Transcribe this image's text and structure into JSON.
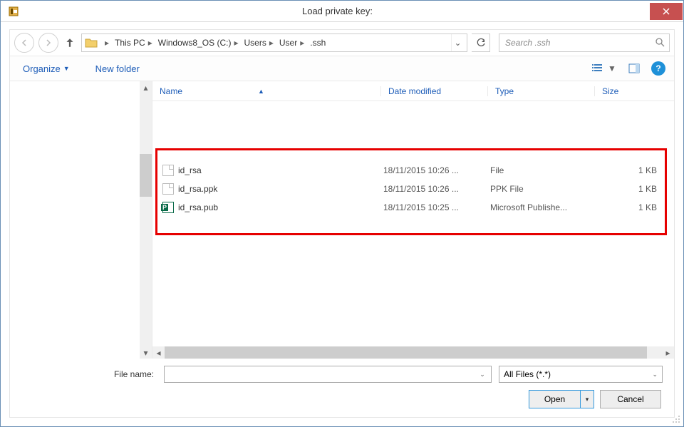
{
  "titlebar": {
    "title": "Load private key:"
  },
  "address": {
    "crumbs": [
      "This PC",
      "Windows8_OS (C:)",
      "Users",
      "User",
      ".ssh"
    ]
  },
  "search": {
    "placeholder": "Search .ssh"
  },
  "toolbar": {
    "organize": "Organize",
    "new_folder": "New folder"
  },
  "columns": {
    "name": "Name",
    "date": "Date modified",
    "type": "Type",
    "size": "Size"
  },
  "files": [
    {
      "name": "id_rsa",
      "date": "18/11/2015 10:26 ...",
      "type": "File",
      "size": "1 KB",
      "icon": "blank"
    },
    {
      "name": "id_rsa.ppk",
      "date": "18/11/2015 10:26 ...",
      "type": "PPK File",
      "size": "1 KB",
      "icon": "blank"
    },
    {
      "name": "id_rsa.pub",
      "date": "18/11/2015 10:25 ...",
      "type": "Microsoft Publishe...",
      "size": "1 KB",
      "icon": "pub"
    }
  ],
  "bottom": {
    "file_name_label": "File name:",
    "file_name_value": "",
    "filter": "All Files (*.*)",
    "open": "Open",
    "cancel": "Cancel"
  }
}
